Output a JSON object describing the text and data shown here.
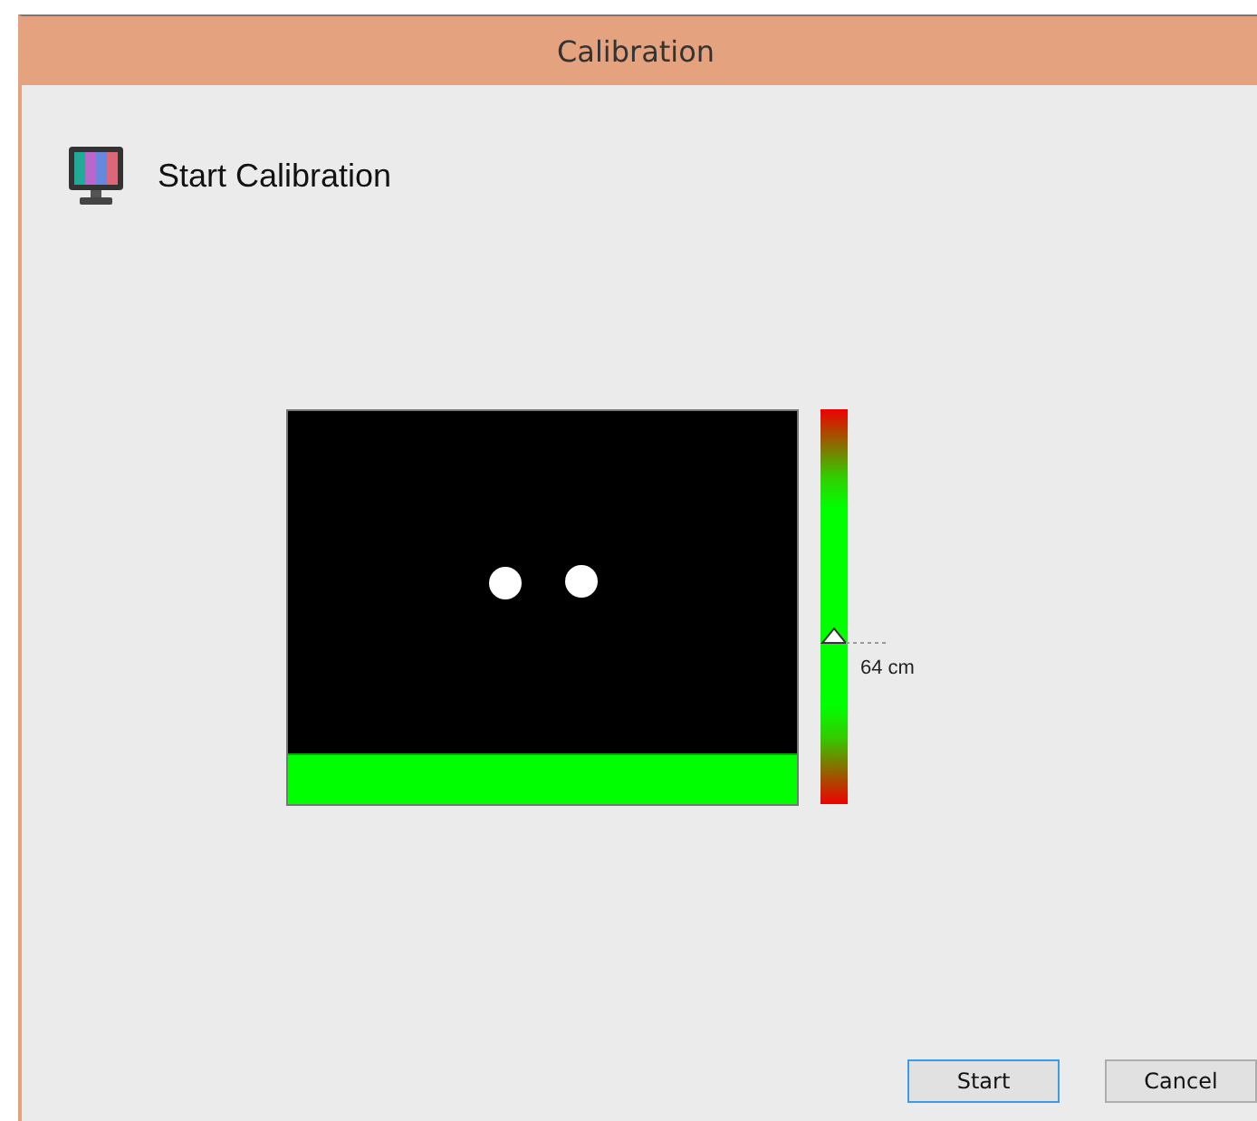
{
  "window": {
    "title": "Calibration"
  },
  "header": {
    "title": "Start Calibration"
  },
  "distance_meter": {
    "level": 0.41,
    "reading": "64 cm"
  },
  "buttons": [
    {
      "label": "Start",
      "focused": true
    },
    {
      "label": "Cancel",
      "focused": false
    }
  ]
}
